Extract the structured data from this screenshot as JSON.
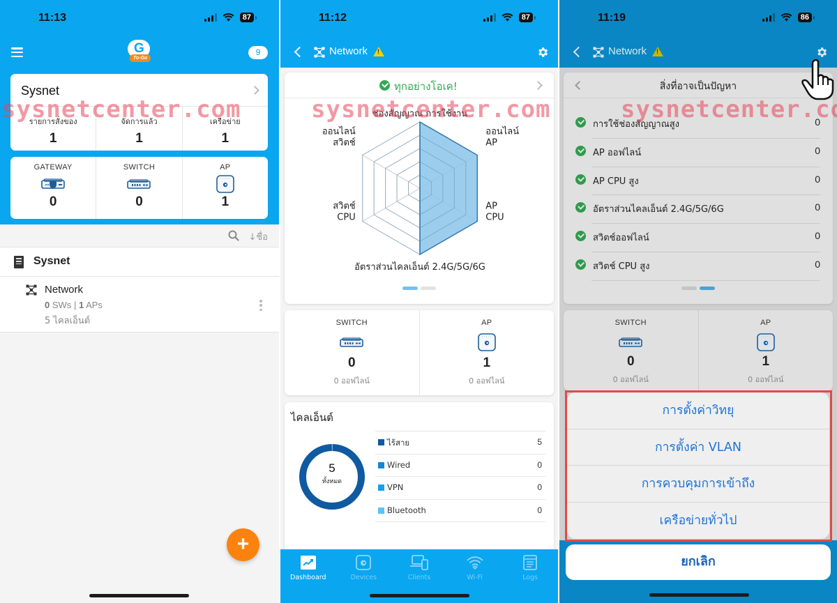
{
  "watermark": "sysnetcenter.com",
  "phone1": {
    "status": {
      "time": "11:13",
      "battery": "87"
    },
    "notifications_count": "9",
    "logo": {
      "letter": "G",
      "tagline": "To-Go"
    },
    "site_card": {
      "name": "Sysnet",
      "stats": [
        {
          "label": "รายการสั่งของ",
          "value": "1"
        },
        {
          "label": "จัดการแล้ว",
          "value": "1"
        },
        {
          "label": "เครือข่าย",
          "value": "1"
        }
      ]
    },
    "devices": [
      {
        "label": "GATEWAY",
        "icon": "gateway-icon",
        "value": "0"
      },
      {
        "label": "SWITCH",
        "icon": "switch-icon",
        "value": "0"
      },
      {
        "label": "AP",
        "icon": "access-point-icon",
        "value": "1"
      }
    ],
    "sort_label": "↓ชื่อ",
    "site_row": {
      "name": "Sysnet"
    },
    "network_row": {
      "name": "Network",
      "sw_count": "0",
      "sw_label": "SWs",
      "separator": "|",
      "ap_count": "1",
      "ap_label": "APs",
      "clients": "5 ไคลเอ็นต์"
    },
    "fab_label": "+"
  },
  "phone2": {
    "status": {
      "time": "11:12",
      "battery": "87"
    },
    "header": {
      "title": "Network"
    },
    "health": {
      "status_text": "ทุกอย่างโอเค!",
      "page": 1,
      "pages": 2
    },
    "devices": [
      {
        "label": "SWITCH",
        "icon": "switch-icon",
        "value": "0",
        "offline": "0 ออฟไลน์"
      },
      {
        "label": "AP",
        "icon": "access-point-icon",
        "value": "1",
        "offline": "0 ออฟไลน์"
      }
    ],
    "clients": {
      "title": "ไคลเอ็นต์",
      "total": "5",
      "total_label": "ทั้งหมด"
    },
    "tabs": [
      {
        "label": "Dashboard",
        "icon": "dashboard-icon",
        "active": true
      },
      {
        "label": "Devices",
        "icon": "devices-icon",
        "active": false
      },
      {
        "label": "Clients",
        "icon": "clients-icon",
        "active": false
      },
      {
        "label": "Wi-Fi",
        "icon": "wifi-icon",
        "active": false
      },
      {
        "label": "Logs",
        "icon": "logs-icon",
        "active": false
      }
    ]
  },
  "phone3": {
    "status": {
      "time": "11:19",
      "battery": "86"
    },
    "header": {
      "title": "Network"
    },
    "issues": {
      "title": "สิ่งที่อาจเป็นปัญหา",
      "items": [
        {
          "label": "การใช้ช่องสัญญาณสูง",
          "value": "0"
        },
        {
          "label": "AP ออฟไลน์",
          "value": "0"
        },
        {
          "label": "AP CPU สูง",
          "value": "0"
        },
        {
          "label": "อัตราส่วนไคลเอ็นต์ 2.4G/5G/6G",
          "value": "0"
        },
        {
          "label": "สวิตช์ออฟไลน์",
          "value": "0"
        },
        {
          "label": "สวิตช์ CPU สูง",
          "value": "0"
        }
      ],
      "page": 2,
      "pages": 2
    },
    "devices": [
      {
        "label": "SWITCH",
        "value": "0",
        "offline": "0 ออฟไลน์"
      },
      {
        "label": "AP",
        "value": "1",
        "offline": "0 ออฟไลน์"
      }
    ],
    "action_sheet": {
      "items": [
        "การตั้งค่าวิทยุ",
        "การตั้งค่า VLAN",
        "การควบคุมการเข้าถึง",
        "เครือข่ายทั่วไป"
      ],
      "cancel": "ยกเลิก"
    }
  },
  "colors": {
    "header_blue": "#0aa6f0",
    "header_dimmed": "#0a86c4",
    "ok_green": "#34a853",
    "fab_orange": "#fb820f",
    "action_blue": "#1e74d2",
    "highlight_red": "#e04a4a",
    "radar_fill": "#8cc4ea",
    "radar_stroke": "#1f6fb2"
  },
  "chart_data": [
    {
      "type": "radar",
      "title": "",
      "axes": [
        "ช่องสัญญาณ การใช้งาน",
        "ออนไลน์ AP",
        "AP CPU",
        "อัตราส่วนไคลเอ็นต์ 2.4G/5G/6G",
        "สวิตช์ CPU",
        "ออนไลน์ สวิตช์"
      ],
      "values": [
        1,
        1,
        1,
        1,
        0,
        0
      ],
      "range": [
        0,
        1
      ],
      "rings": 5
    },
    {
      "type": "pie",
      "title": "ไคลเอ็นต์",
      "categories": [
        "ไร้สาย",
        "Wired",
        "VPN",
        "Bluetooth"
      ],
      "values": [
        5,
        0,
        0,
        0
      ],
      "colors": [
        "#0f5aa0",
        "#1486d6",
        "#1aa0e6",
        "#5cc4f2"
      ],
      "center_value": "5",
      "center_label": "ทั้งหมด",
      "donut": true
    }
  ]
}
